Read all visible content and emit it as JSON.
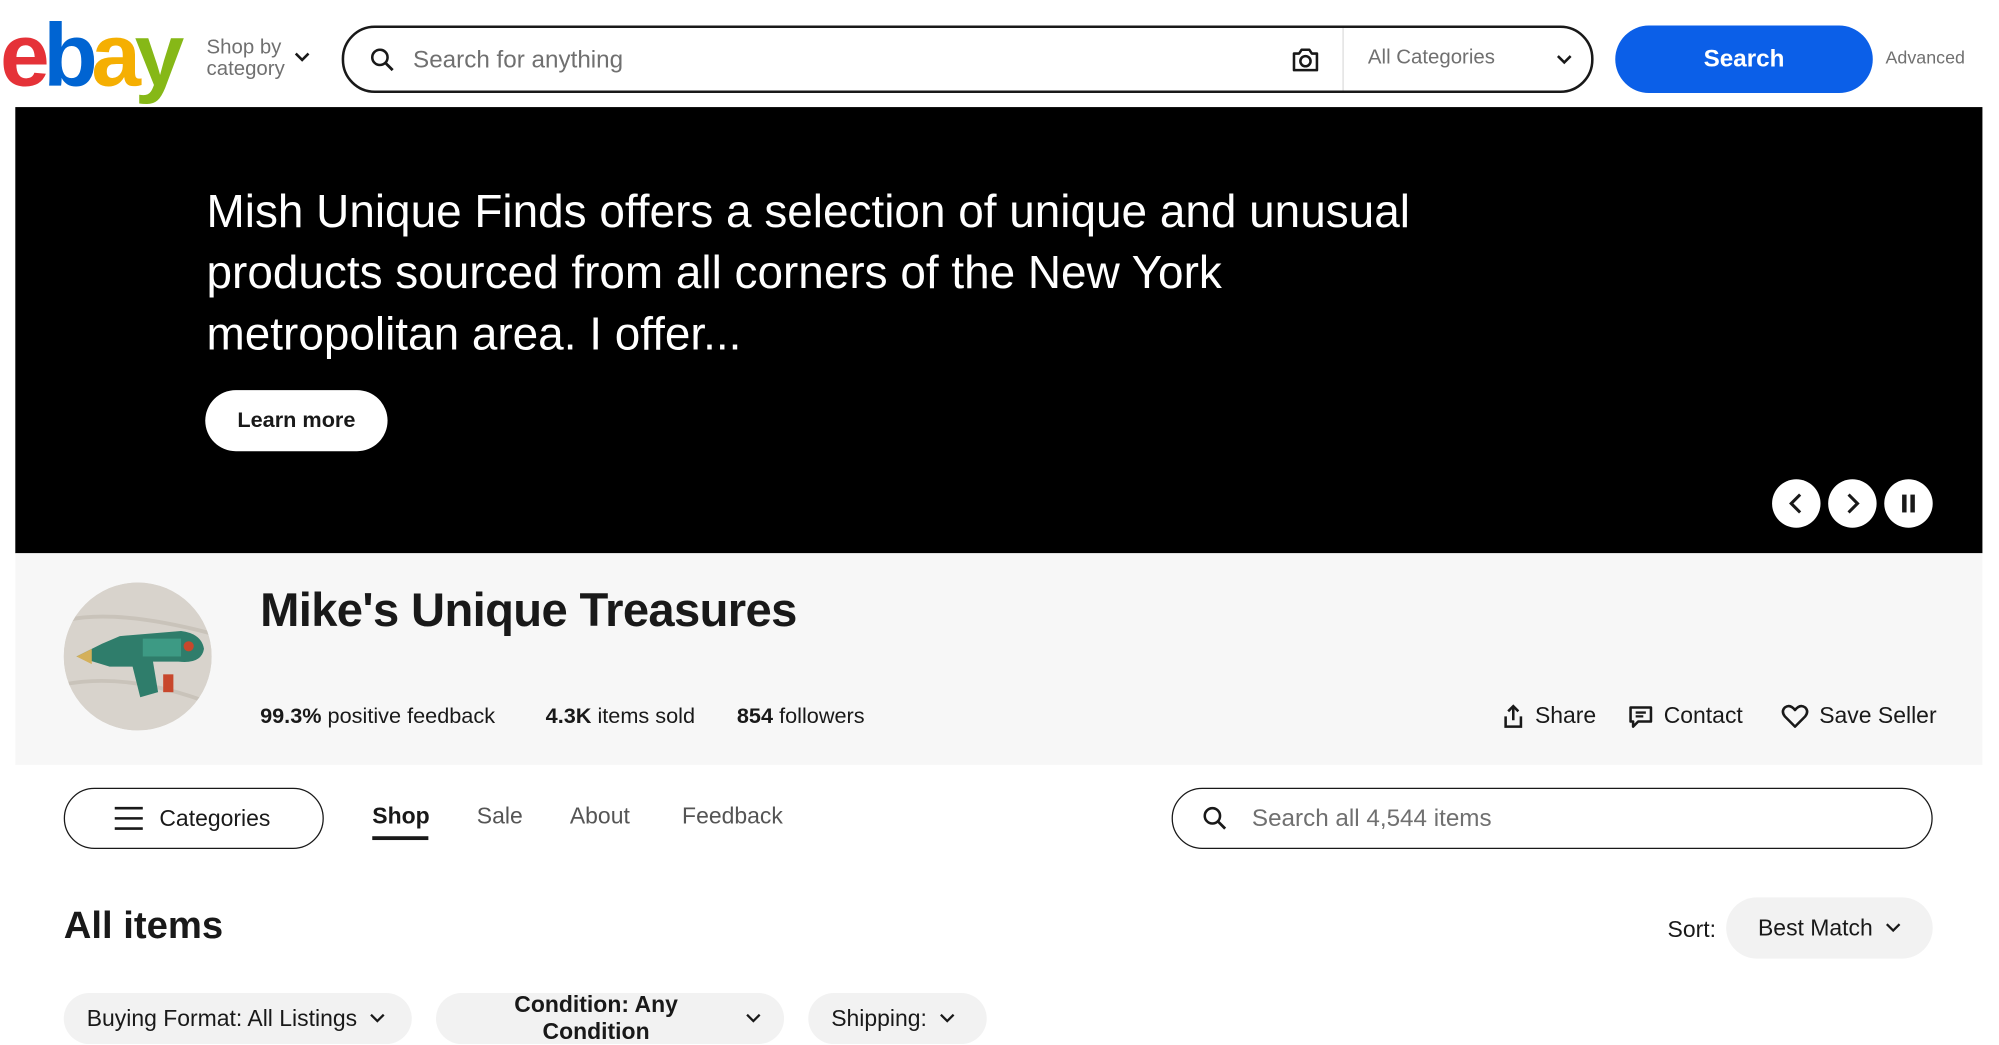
{
  "header": {
    "logo": [
      "e",
      "b",
      "a",
      "y"
    ],
    "shop_by_line1": "Shop by",
    "shop_by_line2": "category",
    "search_placeholder": "Search for anything",
    "category_select": "All Categories",
    "search_button": "Search",
    "advanced_link": "Advanced"
  },
  "banner": {
    "text": "Mish Unique Finds offers a selection of unique and unusual products sourced from all corners of the New York metropolitan area. I offer...",
    "learn_more": "Learn more"
  },
  "store": {
    "name": "Mike's Unique Treasures",
    "feedback_value": "99.3%",
    "feedback_label": "positive feedback",
    "sold_value": "4.3K",
    "sold_label": "items sold",
    "followers_value": "854",
    "followers_label": "followers",
    "share": "Share",
    "contact": "Contact",
    "save_seller": "Save Seller"
  },
  "nav": {
    "categories": "Categories",
    "tabs": [
      "Shop",
      "Sale",
      "About",
      "Feedback"
    ],
    "store_search_placeholder": "Search all 4,544 items"
  },
  "listing": {
    "title": "All items",
    "sort_label": "Sort:",
    "sort_value": "Best Match",
    "filters": [
      "Buying Format: All Listings",
      "Condition: Any Condition",
      "Shipping:"
    ]
  },
  "colors": {
    "logo_e": "#e53238",
    "logo_b": "#0064d2",
    "logo_a": "#f5af02",
    "logo_y": "#86b817",
    "search_button": "#0b5fe8",
    "banner_bg": "#000000"
  }
}
